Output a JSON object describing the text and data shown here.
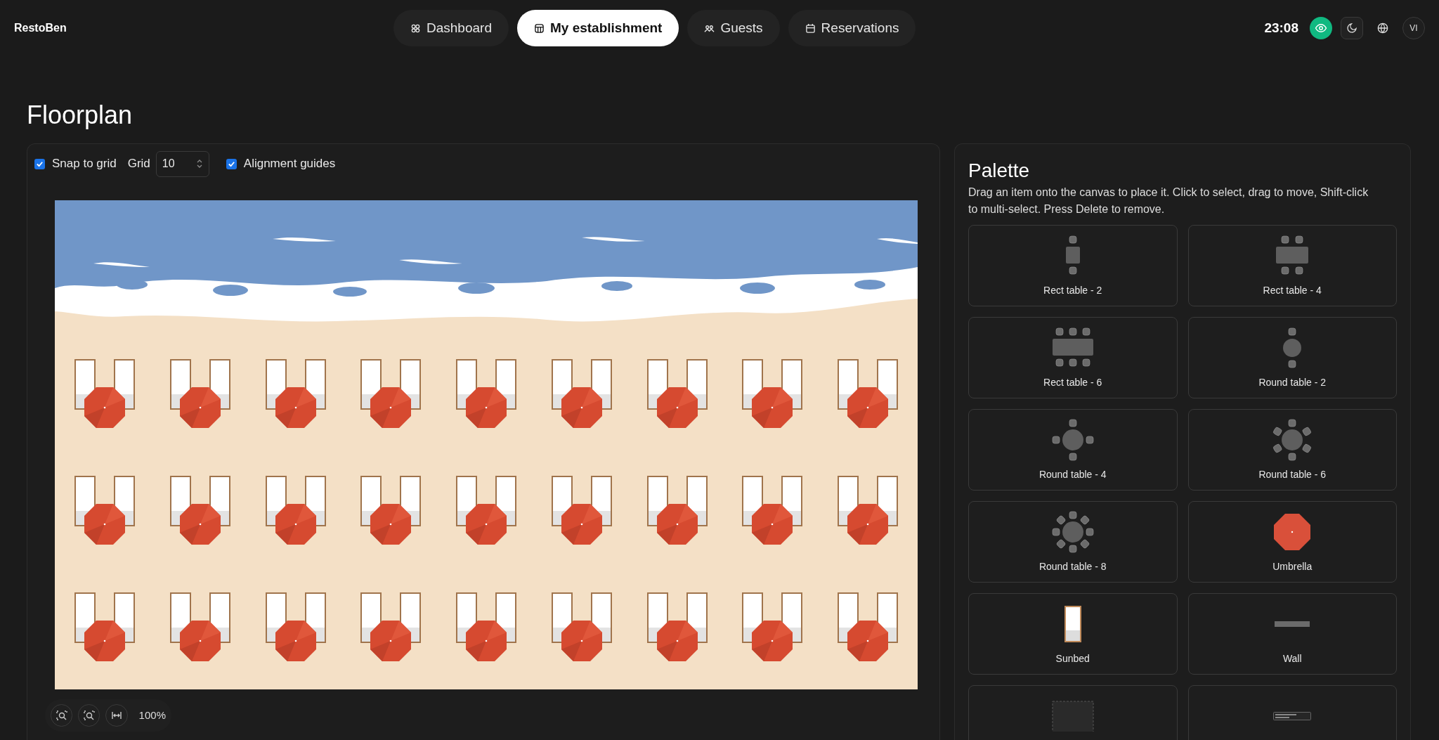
{
  "app": {
    "name": "RestoBen"
  },
  "nav": [
    {
      "label": "Dashboard",
      "kind": "dashboard",
      "selected": false
    },
    {
      "label": "My establishment",
      "kind": "establishment",
      "selected": true
    },
    {
      "label": "Guests",
      "kind": "guests",
      "selected": false
    },
    {
      "label": "Reservations",
      "kind": "calendar",
      "selected": false
    }
  ],
  "header": {
    "time": "23:08",
    "preview_on": true,
    "avatar": "VI"
  },
  "page": {
    "title": "Floorplan"
  },
  "toolbar": {
    "snap": {
      "label": "Snap to grid",
      "checked": true
    },
    "grid": {
      "label": "Grid",
      "value": "10"
    },
    "guides": {
      "label": "Alignment guides",
      "checked": true
    }
  },
  "canvas": {
    "rows": [
      {
        "items": [
          {
            "kind": "lounge_set"
          },
          {
            "kind": "lounge_set"
          },
          {
            "kind": "lounge_set"
          },
          {
            "kind": "lounge_set"
          },
          {
            "kind": "lounge_set"
          },
          {
            "kind": "lounge_set"
          },
          {
            "kind": "lounge_set"
          },
          {
            "kind": "lounge_set"
          },
          {
            "kind": "lounge_set"
          }
        ]
      },
      {
        "items": [
          {
            "kind": "lounge_set"
          },
          {
            "kind": "lounge_set"
          },
          {
            "kind": "lounge_set"
          },
          {
            "kind": "lounge_set"
          },
          {
            "kind": "lounge_set"
          },
          {
            "kind": "lounge_set"
          },
          {
            "kind": "lounge_set"
          },
          {
            "kind": "lounge_set"
          },
          {
            "kind": "lounge_set"
          }
        ]
      },
      {
        "items": [
          {
            "kind": "lounge_set"
          },
          {
            "kind": "lounge_set"
          },
          {
            "kind": "lounge_set"
          },
          {
            "kind": "lounge_set"
          },
          {
            "kind": "lounge_set"
          },
          {
            "kind": "lounge_set"
          },
          {
            "kind": "lounge_set"
          },
          {
            "kind": "lounge_set"
          },
          {
            "kind": "lounge_set"
          }
        ]
      }
    ]
  },
  "zoom": {
    "reading": "100%"
  },
  "palette": {
    "title": "Palette",
    "hint": "Drag an item onto the canvas to place it. Click to select, drag to move, Shift-click to multi-select. Press Delete to remove.",
    "items": [
      {
        "kind": "rect2",
        "label": "Rect table - 2"
      },
      {
        "kind": "rect4",
        "label": "Rect table - 4"
      },
      {
        "kind": "rect6",
        "label": "Rect table - 6"
      },
      {
        "kind": "round2",
        "label": "Round table - 2"
      },
      {
        "kind": "round4",
        "label": "Round table - 4"
      },
      {
        "kind": "round6",
        "label": "Round table - 6"
      },
      {
        "kind": "round8",
        "label": "Round table - 8"
      },
      {
        "kind": "umbrella",
        "label": "Umbrella"
      },
      {
        "kind": "sunbed",
        "label": "Sunbed"
      },
      {
        "kind": "wall",
        "label": "Wall"
      },
      {
        "kind": "zone"
      },
      {
        "kind": "bar"
      }
    ]
  }
}
